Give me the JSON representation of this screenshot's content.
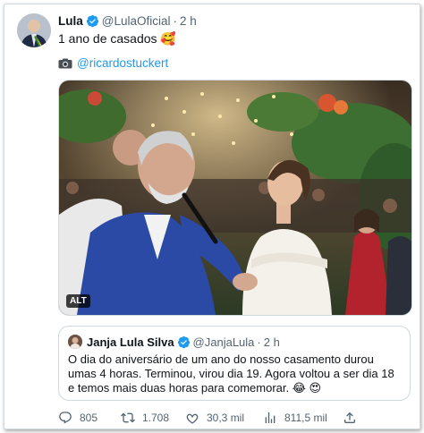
{
  "tweet": {
    "author_name": "Lula",
    "handle": "@LulaOficial",
    "separator": "·",
    "time": "2 h",
    "text": "1 ano de casados 🥰",
    "credit_prefix_icon": "camera-icon",
    "credit_link": "@ricardostuckert",
    "image_alt_badge": "ALT"
  },
  "quote": {
    "author_name": "Janja Lula Silva",
    "handle": "@JanjaLula",
    "separator": "·",
    "time": "2 h",
    "text": "O dia do aniversário de um ano do nosso casamento durou umas 4 horas. Terminou, virou dia 19. Agora voltou a ser dia 18 e temos mais duas horas para comemorar. 😂 😍"
  },
  "actions": {
    "replies": "805",
    "retweets": "1.708",
    "likes": "30,3 mil",
    "views": "811,5 mil"
  },
  "colors": {
    "link": "#1d9bf0",
    "verified": "#1d9bf0",
    "secondary_text": "#536471",
    "border": "#cfd9de"
  }
}
